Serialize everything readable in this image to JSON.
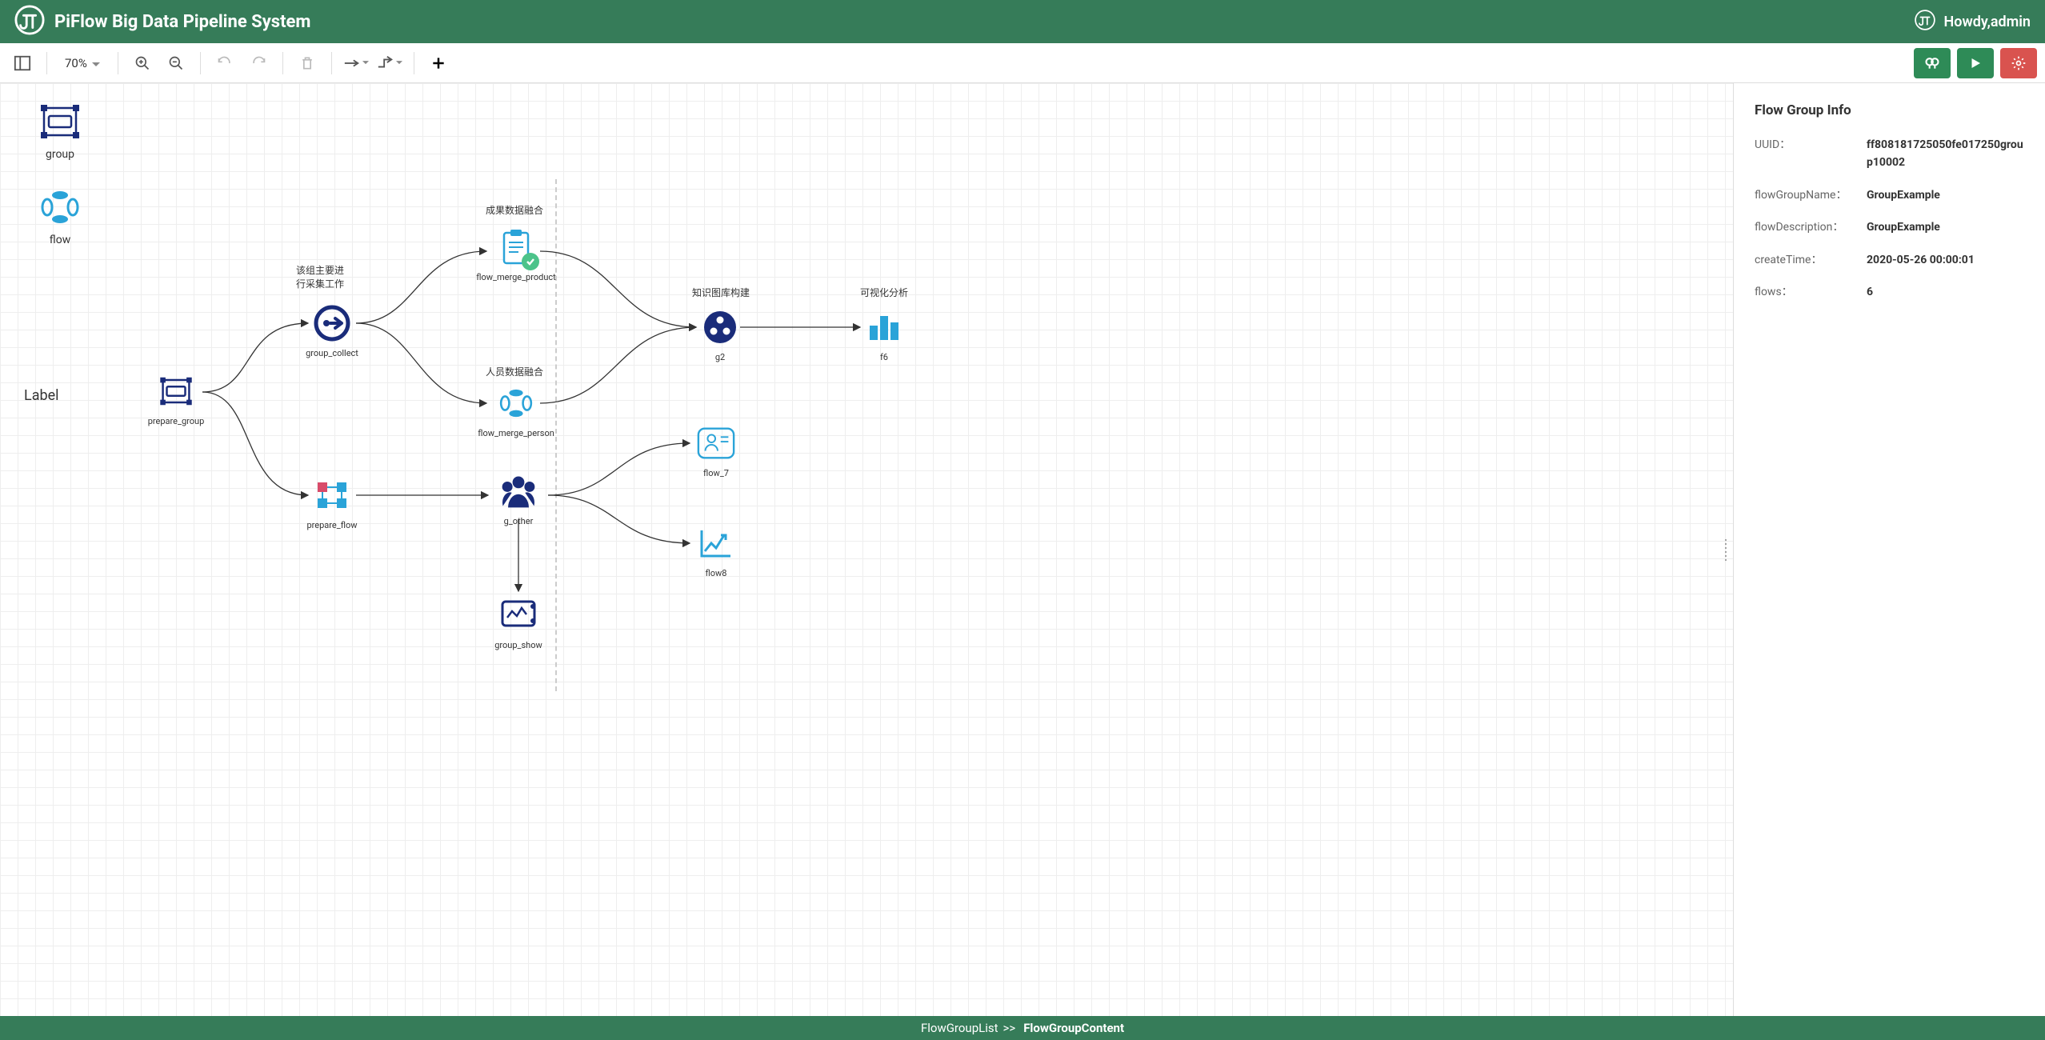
{
  "header": {
    "title": "PiFlow Big Data Pipeline System",
    "greeting": "Howdy,admin"
  },
  "toolbar": {
    "zoom": "70%"
  },
  "palette": {
    "group": "group",
    "flow": "flow",
    "label": "Label"
  },
  "annotations": {
    "collect": "该组主要进\n行采集工作",
    "merge_product": "成果数据融合",
    "merge_person": "人员数据融合",
    "knowledge": "知识图库构建",
    "viz": "可视化分析"
  },
  "nodes": {
    "prepare_group": "prepare_group",
    "group_collect": "group_collect",
    "prepare_flow": "prepare_flow",
    "flow_merge_product": "flow_merge_product",
    "flow_merge_person": "flow_merge_person",
    "g_other": "g_other",
    "group_show": "group_show",
    "g2": "g2",
    "f6": "f6",
    "flow_7": "flow_7",
    "flow8": "flow8"
  },
  "info": {
    "title": "Flow Group Info",
    "uuid_key": "UUID：",
    "uuid_val": "ff808181725050fe017250group10002",
    "name_key": "flowGroupName：",
    "name_val": "GroupExample",
    "desc_key": "flowDescription：",
    "desc_val": "GroupExample",
    "time_key": "createTime：",
    "time_val": "2020-05-26 00:00:01",
    "flows_key": "flows：",
    "flows_val": "6"
  },
  "breadcrumb": {
    "parent": "FlowGroupList",
    "sep": ">>",
    "current": "FlowGroupContent"
  }
}
